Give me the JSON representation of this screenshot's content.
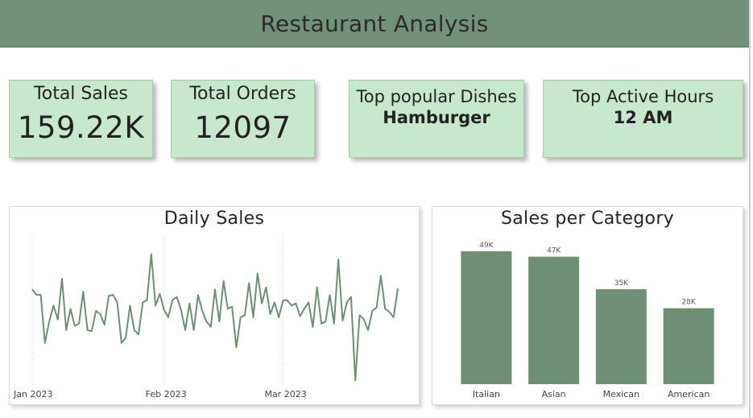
{
  "header": {
    "title": "Restaurant Analysis"
  },
  "kpis": {
    "total_sales": {
      "label": "Total Sales",
      "value": "159.22K"
    },
    "total_orders": {
      "label": "Total Orders",
      "value": "12097"
    },
    "top_dish": {
      "label": "Top popular Dishes",
      "value": "Hamburger"
    },
    "top_hour": {
      "label": "Top Active Hours",
      "value": "12 AM"
    }
  },
  "colors": {
    "accent": "#72917a",
    "kpi_bg": "#c8e8cd",
    "series": "#6e8f75"
  },
  "chart_data": [
    {
      "type": "line",
      "title": "Daily Sales",
      "xlabel": "",
      "ylabel": "",
      "x_ticks": [
        "Jan 2023",
        "Feb 2023",
        "Mar 2023"
      ],
      "x_tick_index": [
        0,
        31,
        59
      ],
      "grid": true,
      "ylim": [
        1000,
        2400
      ],
      "x": [
        "2023-01-01",
        "2023-01-02",
        "2023-01-03",
        "2023-01-04",
        "2023-01-05",
        "2023-01-06",
        "2023-01-07",
        "2023-01-08",
        "2023-01-09",
        "2023-01-10",
        "2023-01-11",
        "2023-01-12",
        "2023-01-13",
        "2023-01-14",
        "2023-01-15",
        "2023-01-16",
        "2023-01-17",
        "2023-01-18",
        "2023-01-19",
        "2023-01-20",
        "2023-01-21",
        "2023-01-22",
        "2023-01-23",
        "2023-01-24",
        "2023-01-25",
        "2023-01-26",
        "2023-01-27",
        "2023-01-28",
        "2023-01-29",
        "2023-01-30",
        "2023-01-31",
        "2023-02-01",
        "2023-02-02",
        "2023-02-03",
        "2023-02-04",
        "2023-02-05",
        "2023-02-06",
        "2023-02-07",
        "2023-02-08",
        "2023-02-09",
        "2023-02-10",
        "2023-02-11",
        "2023-02-12",
        "2023-02-13",
        "2023-02-14",
        "2023-02-15",
        "2023-02-16",
        "2023-02-17",
        "2023-02-18",
        "2023-02-19",
        "2023-02-20",
        "2023-02-21",
        "2023-02-22",
        "2023-02-23",
        "2023-02-24",
        "2023-02-25",
        "2023-02-26",
        "2023-02-27",
        "2023-02-28",
        "2023-03-01",
        "2023-03-02",
        "2023-03-03",
        "2023-03-04",
        "2023-03-05",
        "2023-03-06",
        "2023-03-07",
        "2023-03-08",
        "2023-03-09",
        "2023-03-10",
        "2023-03-11",
        "2023-03-12",
        "2023-03-13",
        "2023-03-14",
        "2023-03-15",
        "2023-03-16",
        "2023-03-17",
        "2023-03-18",
        "2023-03-19",
        "2023-03-20",
        "2023-03-21",
        "2023-03-22",
        "2023-03-23",
        "2023-03-24",
        "2023-03-25",
        "2023-03-26",
        "2023-03-27",
        "2023-03-28",
        "2023-03-29",
        "2023-03-30",
        "2023-03-31"
      ],
      "series": [
        {
          "values": [
            1900,
            1850,
            1850,
            1400,
            1600,
            1750,
            1620,
            2000,
            1520,
            1720,
            1560,
            1580,
            1880,
            1520,
            1510,
            1700,
            1670,
            1570,
            1840,
            1850,
            1780,
            1400,
            1450,
            1750,
            1520,
            1480,
            1780,
            1800,
            2230,
            1750,
            1860,
            1710,
            1640,
            1800,
            1830,
            1710,
            1520,
            1770,
            1520,
            1850,
            1700,
            1600,
            1550,
            1900,
            1600,
            1980,
            1720,
            1740,
            1360,
            1640,
            1660,
            1960,
            1640,
            2050,
            1770,
            1920,
            1670,
            1780,
            1640,
            1800,
            1800,
            1750,
            1770,
            1650,
            1720,
            1780,
            1550,
            1920,
            1580,
            1600,
            1850,
            1580,
            2180,
            1610,
            1780,
            1830,
            1050,
            1660,
            1620,
            1520,
            1700,
            1730,
            2030,
            1720,
            1690,
            1640,
            1910
          ],
          "color": "#6e8f75"
        }
      ]
    },
    {
      "type": "bar",
      "title": "Sales per Category",
      "xlabel": "",
      "ylabel": "",
      "categories": [
        "Italian",
        "Asian",
        "Mexican",
        "American"
      ],
      "values": [
        49,
        47,
        35,
        28
      ],
      "data_labels": [
        "49K",
        "47K",
        "35K",
        "28K"
      ],
      "ylim": [
        0,
        49
      ],
      "grid": false,
      "color": "#6e8f75"
    }
  ]
}
